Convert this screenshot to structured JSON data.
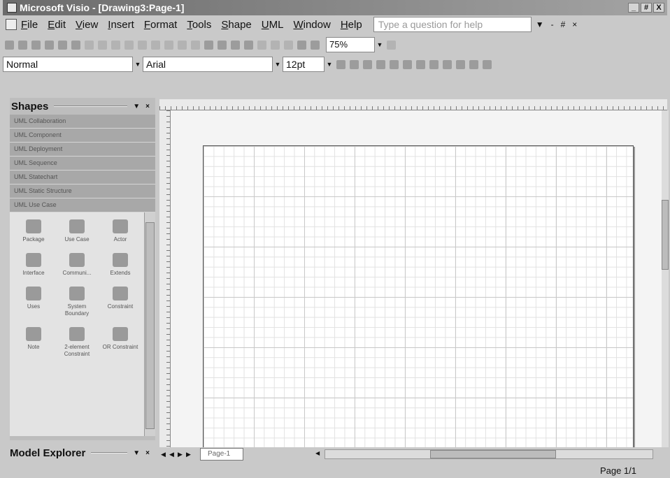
{
  "window": {
    "title": "Microsoft Visio - [Drawing3:Page-1]",
    "controls": [
      "_",
      "#",
      "X"
    ]
  },
  "menubar": {
    "items": [
      "File",
      "Edit",
      "View",
      "Insert",
      "Format",
      "Tools",
      "Shape",
      "UML",
      "Window",
      "Help"
    ],
    "help_placeholder": "Type a question for help",
    "trail": [
      "▼",
      "-",
      "#",
      "×"
    ]
  },
  "toolbar": {
    "zoom": "75%"
  },
  "format_toolbar": {
    "style": "Normal",
    "font": "Arial",
    "size": "12pt"
  },
  "shapes_panel": {
    "title": "Shapes",
    "stencils": [
      "UML Collaboration",
      "UML Component",
      "UML Deployment",
      "UML Sequence",
      "UML Statechart",
      "UML Static Structure",
      "UML Use Case"
    ],
    "shapes": [
      {
        "label": "Package",
        "icon": "package-icon"
      },
      {
        "label": "Use Case",
        "icon": "use-case-icon"
      },
      {
        "label": "Actor",
        "icon": "actor-icon"
      },
      {
        "label": "Interface",
        "icon": "interface-icon"
      },
      {
        "label": "Communi...",
        "icon": "communicates-icon"
      },
      {
        "label": "Extends",
        "icon": "extends-icon"
      },
      {
        "label": "Uses",
        "icon": "uses-icon"
      },
      {
        "label": "System Boundary",
        "icon": "system-boundary-icon"
      },
      {
        "label": "Constraint",
        "icon": "constraint-icon"
      },
      {
        "label": "Note",
        "icon": "note-icon"
      },
      {
        "label": "2-element Constraint",
        "icon": "two-element-constraint-icon"
      },
      {
        "label": "OR Constraint",
        "icon": "or-constraint-icon"
      }
    ]
  },
  "model_explorer": {
    "title": "Model Explorer"
  },
  "page_tabs": {
    "active": "Page-1"
  },
  "status": {
    "page": "Page 1/1"
  }
}
